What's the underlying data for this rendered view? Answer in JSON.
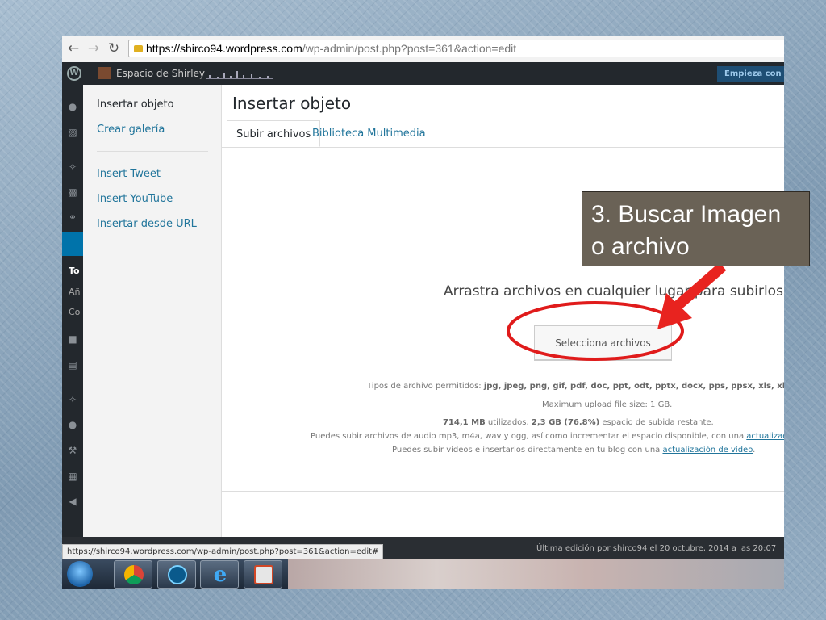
{
  "browser": {
    "url_host": "https://shirco94.wordpress.com",
    "url_path": "/wp-admin/post.php?post=361&action=edit",
    "back_icon": "arrow-left",
    "forward_icon": "arrow-right",
    "reload_icon": "reload",
    "lock_icon": "lock"
  },
  "admin_bar": {
    "site_name": "Espacio de Shirley",
    "cta_label": "Empieza con Pr"
  },
  "wp_sidebar_fragments": [
    "To",
    "Añ",
    "Co"
  ],
  "modal": {
    "title": "Insertar objeto",
    "menu": {
      "insert": "Insertar objeto",
      "gallery": "Crear galería",
      "tweet": "Insert Tweet",
      "youtube": "Insert YouTube",
      "url": "Insertar desde URL"
    },
    "tabs": {
      "upload": "Subir archivos",
      "library": "Biblioteca Multimedia"
    },
    "uploader": {
      "drop_text": "Arrastra archivos en cualquier lugar para subirlos",
      "button": "Selecciona archivos",
      "types_prefix": "Tipos de archivo permitidos: ",
      "types": "jpg, jpeg, png, gif, pdf, doc, ppt, odt, pptx, docx, pps, ppsx, xls, xlsx, key.",
      "max_size": "Maximum upload file size: 1 GB.",
      "used": "714,1 MB",
      "used_suffix": " utilizados, ",
      "remaining": "2,3 GB (76.8%)",
      "remaining_suffix": " espacio de subida restante.",
      "audio_text": "Puedes subir archivos de audio mp3, m4a, wav y ogg, así como incrementar el espacio disponible, con una ",
      "audio_link": "actualización de",
      "video_text": "Puedes subir vídeos e insertarlos directamente en tu blog con una ",
      "video_link": "actualización de vídeo",
      "video_end": "."
    }
  },
  "status_url": "https://shirco94.wordpress.com/wp-admin/post.php?post=361&action=edit#",
  "last_edit": "Última edición por shirco94 el 20 octubre, 2014 a las 20:07",
  "taskbar": {
    "apps": [
      "start-orb",
      "chrome-icon",
      "clock-app-icon",
      "internet-explorer-icon",
      "powerpoint-icon"
    ]
  },
  "annotation": {
    "text": "3. Buscar  Imagen\no archivo",
    "box_color": "#6a6256",
    "arrow_color": "#e8231f",
    "ellipse_color": "#e01b1b"
  }
}
